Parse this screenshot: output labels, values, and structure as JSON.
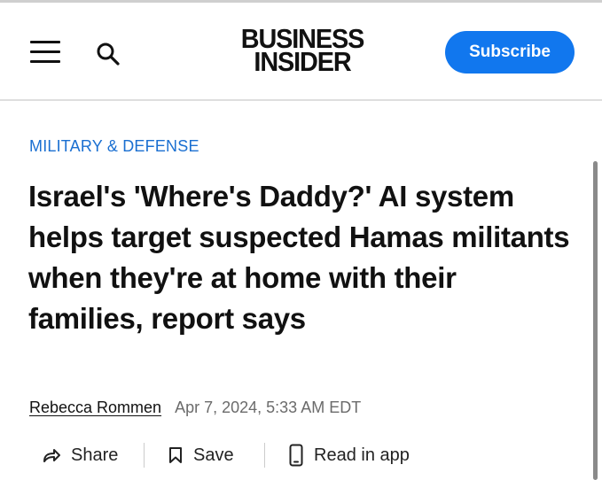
{
  "header": {
    "logo_line1": "BUSINESS",
    "logo_line2": "INSIDER",
    "subscribe_label": "Subscribe",
    "menu_icon": "hamburger-menu-icon",
    "search_icon": "search-icon"
  },
  "article": {
    "category": "MILITARY & DEFENSE",
    "headline": "Israel's 'Where's Daddy?' AI system helps target suspected Hamas militants when they're at home with their families, report says",
    "author": "Rebecca Rommen",
    "date": "Apr 7, 2024, 5:33 AM EDT"
  },
  "actions": {
    "share_label": "Share",
    "save_label": "Save",
    "read_in_app_label": "Read in app"
  },
  "colors": {
    "subscribe_bg": "#1177ee",
    "category": "#1a6fd1"
  }
}
